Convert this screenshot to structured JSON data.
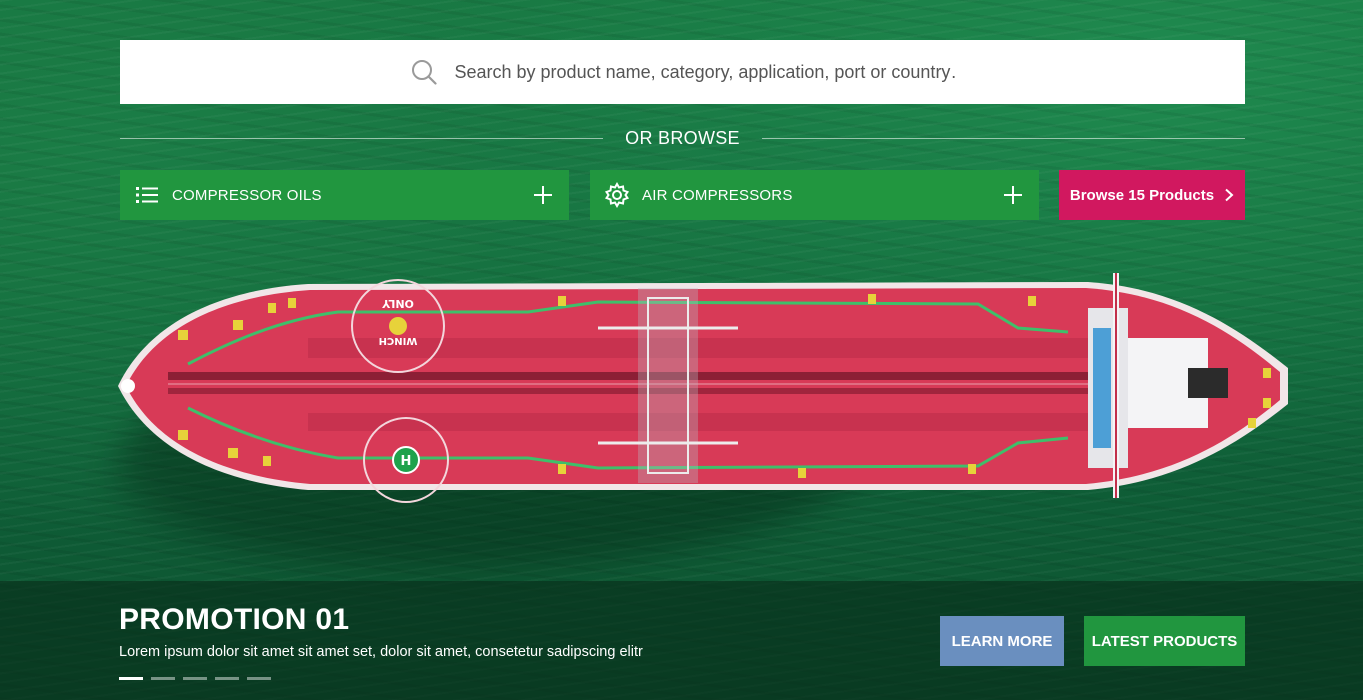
{
  "search": {
    "placeholder": "Search by product name, category, application, port or country…",
    "icon": "search-icon"
  },
  "browse": {
    "divider_label": "OR BROWSE",
    "category_select": {
      "label": "COMPRESSOR OILS",
      "icon": "list-icon"
    },
    "application_select": {
      "label": "AIR COMPRESSORS",
      "icon": "gear-icon"
    },
    "browse_button": "Browse 15 Products"
  },
  "hero": {
    "deck_labels": {
      "winch": "WINCH",
      "only": "ONLY",
      "helipad": "H"
    }
  },
  "promo": {
    "title": "PROMOTION 01",
    "text": "Lorem ipsum dolor sit amet sit amet set, dolor sit amet, consetetur sadipscing elitr",
    "slides_total": 5,
    "active_slide": 1,
    "learn_more": "LEARN MORE",
    "latest_products": "LATEST PRODUCTS"
  },
  "colors": {
    "green": "#21963f",
    "magenta": "#d1185f",
    "blue_grey": "#6a8fbf",
    "hull": "#d83a57"
  }
}
